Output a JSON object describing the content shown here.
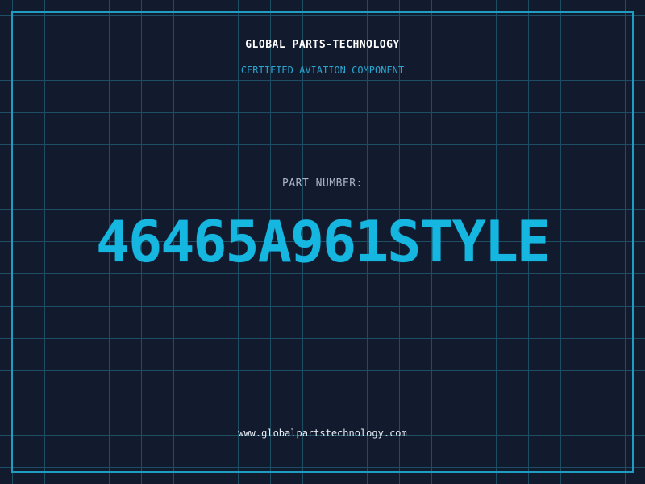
{
  "header": {
    "company": "GLOBAL PARTS-TECHNOLOGY",
    "tagline": "CERTIFIED AVIATION COMPONENT"
  },
  "part": {
    "label": "PART NUMBER:",
    "number": "46465A961STYLE"
  },
  "footer": {
    "website": "www.globalpartstechnology.com"
  },
  "colors": {
    "background": "#121a2e",
    "grid": "#1d4e63",
    "frame": "#1f9cc2",
    "accent": "#15b7e0"
  }
}
